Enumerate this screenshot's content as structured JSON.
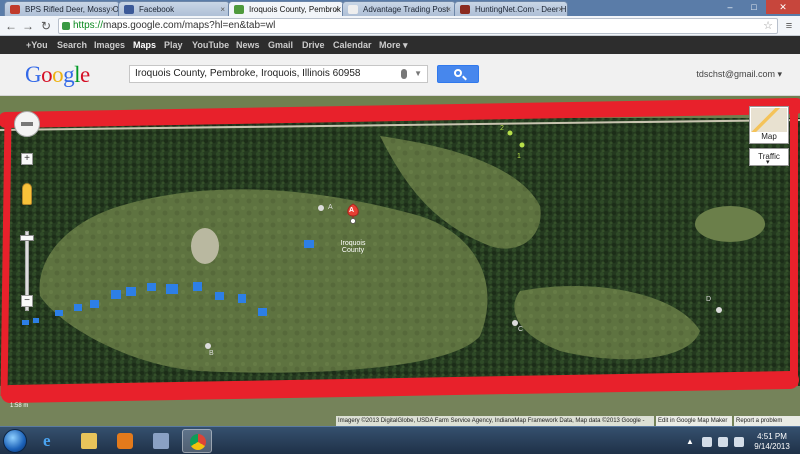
{
  "browser": {
    "tabs": [
      {
        "title": "BPS Rifled Deer, Mossy Oa",
        "active": false,
        "icon_color": "#c03a2b"
      },
      {
        "title": "Facebook",
        "active": false,
        "icon_color": "#3b5998"
      },
      {
        "title": "Iroquois County, Pembrok",
        "active": true,
        "icon_color": "#4f9a3c"
      },
      {
        "title": "Advantage Trading Post",
        "active": false,
        "icon_color": "#eeeeee"
      },
      {
        "title": "HuntingNet.Com - Deer H",
        "active": false,
        "icon_color": "#8b2b20"
      }
    ],
    "url_scheme": "https://",
    "url_rest": "maps.google.com/maps?hl=en&tab=wl"
  },
  "gbar": {
    "links": [
      {
        "label": "+You",
        "active": false
      },
      {
        "label": "Search",
        "active": false
      },
      {
        "label": "Images",
        "active": false
      },
      {
        "label": "Maps",
        "active": true
      },
      {
        "label": "Play",
        "active": false
      },
      {
        "label": "YouTube",
        "active": false
      },
      {
        "label": "News",
        "active": false
      },
      {
        "label": "Gmail",
        "active": false
      },
      {
        "label": "Drive",
        "active": false
      },
      {
        "label": "Calendar",
        "active": false
      },
      {
        "label": "More ▾",
        "active": false
      }
    ]
  },
  "header": {
    "logo_letters": [
      "G",
      "o",
      "o",
      "g",
      "l",
      "e"
    ],
    "logo_colors": [
      "#3369e8",
      "#d50f25",
      "#eeb211",
      "#3369e8",
      "#009925",
      "#d50f25"
    ],
    "search_value": "Iroquois County, Pembroke, Iroquois, Illinois 60958",
    "user": "tdschst@gmail.com ▾"
  },
  "map": {
    "marker_letter": "A",
    "marker_label": "Iroquois County",
    "point_labels": [
      "A",
      "B",
      "C",
      "D"
    ],
    "waypoint_labels": [
      "1",
      "2"
    ],
    "zoom_in": "+",
    "zoom_out": "−",
    "map_type": "Map",
    "traffic": "Traffic",
    "scale": "1:58 m",
    "attribution": "Imagery ©2013 DigitalGlobe, USDA Farm Service Agency, IndianaMap Framework Data, Map data ©2013 Google -",
    "edit_link": "Edit in Google Map Maker",
    "report_link": "Report a problem"
  },
  "taskbar": {
    "time": "4:51 PM",
    "date": "9/14/2013"
  },
  "colors": {
    "outline_red": "#e8212b",
    "pond_blue": "#2d7fe6",
    "waypoint_yellow": "#b8e04a"
  }
}
